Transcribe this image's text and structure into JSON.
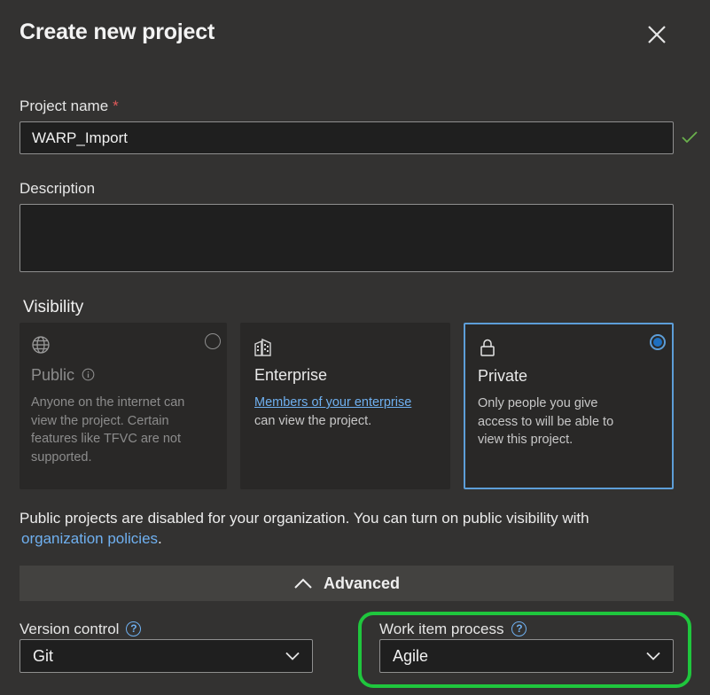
{
  "dialog": {
    "title": "Create new project"
  },
  "project_name": {
    "label": "Project name",
    "required_mark": "*",
    "value": "WARP_Import"
  },
  "description": {
    "label": "Description",
    "value": ""
  },
  "visibility": {
    "heading": "Visibility",
    "options": [
      {
        "title": "Public",
        "description": "Anyone on the internet can view the project. Certain features like TFVC are not supported.",
        "selected": false,
        "disabled": true
      },
      {
        "title": "Enterprise",
        "link_text": "Members of your enterprise",
        "description_suffix": " can view the project.",
        "selected": false
      },
      {
        "title": "Private",
        "description": "Only people you give access to will be able to view this project.",
        "selected": true
      }
    ]
  },
  "public_note": {
    "text": "Public projects are disabled for your organization. You can turn on public visibility with",
    "link_text": "organization policies",
    "trailing": "."
  },
  "advanced": {
    "label": "Advanced"
  },
  "version_control": {
    "label": "Version control",
    "value": "Git"
  },
  "work_item_process": {
    "label": "Work item process",
    "value": "Agile"
  },
  "colors": {
    "accent_blue": "#5d9ed8",
    "link": "#6fb0f0",
    "highlight_green": "#1fc63d",
    "valid_check": "#6ab04c",
    "required": "#e05a5a"
  }
}
